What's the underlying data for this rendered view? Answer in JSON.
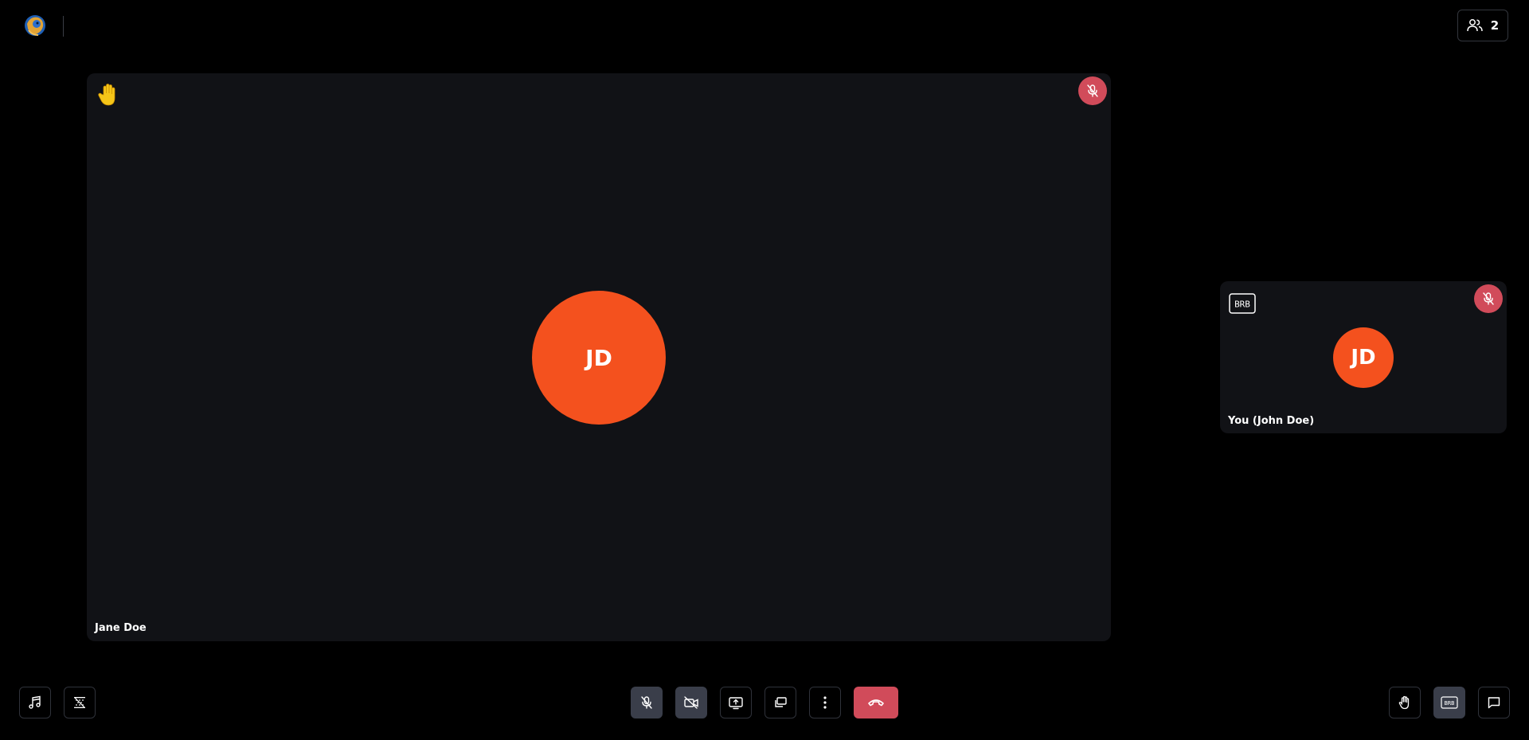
{
  "header": {
    "logo_icon": "lion-logo-icon",
    "participants": {
      "icon": "users-icon",
      "count": "2"
    }
  },
  "main_tile": {
    "participant_name": "Jane Doe",
    "avatar_initials": "JD",
    "status_icon": "raised-hand-icon",
    "muted_icon": "mic-off-icon"
  },
  "self_tile": {
    "participant_name": "You (John Doe)",
    "avatar_initials": "JD",
    "status_icon": "brb-icon",
    "muted_icon": "mic-off-icon"
  },
  "toolbar": {
    "left": [
      "music-note-icon",
      "background-blur-icon"
    ],
    "center": [
      "mic-off-icon",
      "camera-off-icon",
      "share-screen-icon",
      "picture-in-picture-icon",
      "more-options-icon",
      "end-call-icon"
    ],
    "right": [
      "raise-hand-icon",
      "brb-icon",
      "chat-icon"
    ]
  },
  "colors": {
    "background": "#000000",
    "tile": "#111216",
    "avatar": "#f4511e",
    "muted_badge": "#d14b5a",
    "end_call": "#d14b5a",
    "active_button": "#3a3e4a",
    "hand_emoji": "#f5c518"
  }
}
